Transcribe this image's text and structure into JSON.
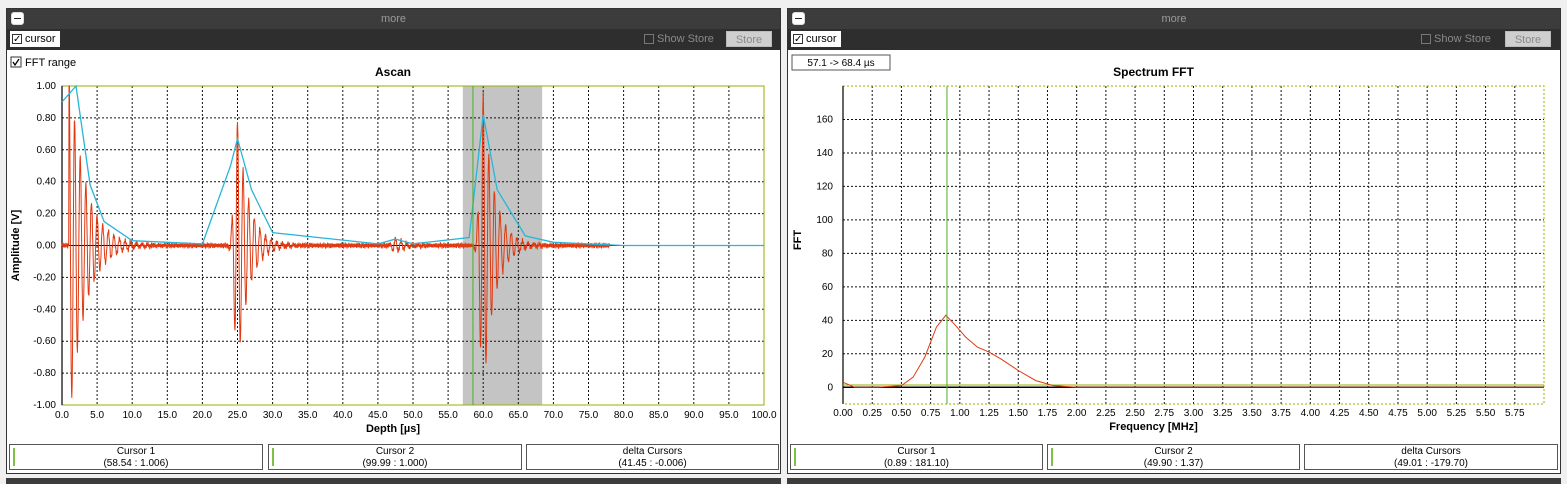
{
  "colors": {
    "trace": "#e03a12",
    "envelope": "#29b6d6",
    "cursor": "#4caf27",
    "grid": "#111111",
    "axis_box": "#9ab000",
    "gate": "#c4c4c4"
  },
  "left": {
    "title_bar": "more",
    "cursor_label": "cursor",
    "cursor_checked": true,
    "show_store_label": "Show Store",
    "store_button": "Store",
    "fft_range_label": "FFT range",
    "fft_range_checked": true,
    "cursor1": {
      "title": "Cursor 1",
      "value": "(58.54 : 1.006)"
    },
    "cursor2": {
      "title": "Cursor 2",
      "value": "(99.99 : 1.000)"
    },
    "delta": {
      "title": "delta Cursors",
      "value": "(41.45 : -0.006)"
    }
  },
  "right": {
    "title_bar": "more",
    "cursor_label": "cursor",
    "cursor_checked": true,
    "show_store_label": "Show Store",
    "store_button": "Store",
    "range_readout": "57.1 -> 68.4 µs",
    "cursor1": {
      "title": "Cursor 1",
      "value": "(0.89 : 181.10)"
    },
    "cursor2": {
      "title": "Cursor 2",
      "value": "(49.90 : 1.37)"
    },
    "delta": {
      "title": "delta Cursors",
      "value": "(49.01 : -179.70)"
    }
  },
  "chart_data": [
    {
      "type": "line",
      "title": "Ascan",
      "xlabel": "Depth [µs]",
      "ylabel": "Amplitude [V]",
      "xlim": [
        0,
        100
      ],
      "ylim": [
        -1,
        1
      ],
      "xticks": [
        "0.0",
        "5.0",
        "10.0",
        "15.0",
        "20.0",
        "25.0",
        "30.0",
        "35.0",
        "40.0",
        "45.0",
        "50.0",
        "55.0",
        "60.0",
        "65.0",
        "70.0",
        "75.0",
        "80.0",
        "85.0",
        "90.0",
        "95.0",
        "100.0"
      ],
      "yticks": [
        "1.00",
        "0.80",
        "0.60",
        "0.40",
        "0.20",
        "0.00",
        "-0.20",
        "-0.40",
        "-0.60",
        "-0.80",
        "-1.00"
      ],
      "grid": true,
      "gate_range": [
        57.1,
        68.4
      ],
      "cursor_x": 58.54,
      "echoes": [
        {
          "center": 1.0,
          "amplitude": 1.0
        },
        {
          "center": 25.0,
          "amplitude": 0.68
        },
        {
          "center": 47.5,
          "amplitude": 0.04
        },
        {
          "center": 60.0,
          "amplitude": 0.82
        }
      ],
      "series": [
        {
          "values_description": "rf_signal",
          "x": [
            0,
            1,
            2,
            3,
            4,
            5,
            24,
            25,
            26,
            59,
            60,
            61,
            78
          ],
          "y": [
            1.0,
            -1.0,
            0.9,
            -0.9,
            0.35,
            -0.15,
            0.2,
            -0.72,
            0.6,
            -0.5,
            0.8,
            -0.92,
            0.0
          ]
        },
        {
          "values_description": "envelope",
          "x": [
            0,
            2,
            4,
            6,
            10,
            20,
            24,
            25,
            27,
            30,
            45,
            47.5,
            50,
            58,
            60,
            62,
            66,
            70,
            80,
            100
          ],
          "y": [
            0.9,
            1.0,
            0.38,
            0.15,
            0.03,
            0.01,
            0.5,
            0.67,
            0.35,
            0.08,
            0.01,
            0.04,
            0.01,
            0.05,
            0.82,
            0.35,
            0.06,
            0.02,
            0.0,
            0.0
          ]
        }
      ]
    },
    {
      "type": "line",
      "title": "Spectrum FFT",
      "xlabel": "Frequency [MHz]",
      "ylabel": "FFT",
      "xlim": [
        0,
        6.0
      ],
      "ylim": [
        -10,
        180
      ],
      "xticks": [
        "0.00",
        "0.25",
        "0.50",
        "0.75",
        "1.00",
        "1.25",
        "1.50",
        "1.75",
        "2.00",
        "2.25",
        "2.50",
        "2.75",
        "3.00",
        "3.25",
        "3.50",
        "3.75",
        "4.00",
        "4.25",
        "4.50",
        "4.75",
        "5.00",
        "5.25",
        "5.50",
        "5.75"
      ],
      "yticks": [
        "160",
        "140",
        "120",
        "100",
        "80",
        "60",
        "40",
        "20",
        "0"
      ],
      "grid": true,
      "cursor_x": 0.89,
      "series": [
        {
          "x": [
            0.0,
            0.1,
            0.3,
            0.5,
            0.6,
            0.7,
            0.8,
            0.88,
            0.95,
            1.05,
            1.15,
            1.25,
            1.35,
            1.5,
            1.65,
            1.8,
            2.0,
            6.0
          ],
          "y": [
            3,
            0,
            0,
            1,
            6,
            18,
            36,
            43,
            38,
            30,
            24,
            21,
            17,
            10,
            4,
            1,
            0,
            0
          ]
        }
      ]
    }
  ]
}
